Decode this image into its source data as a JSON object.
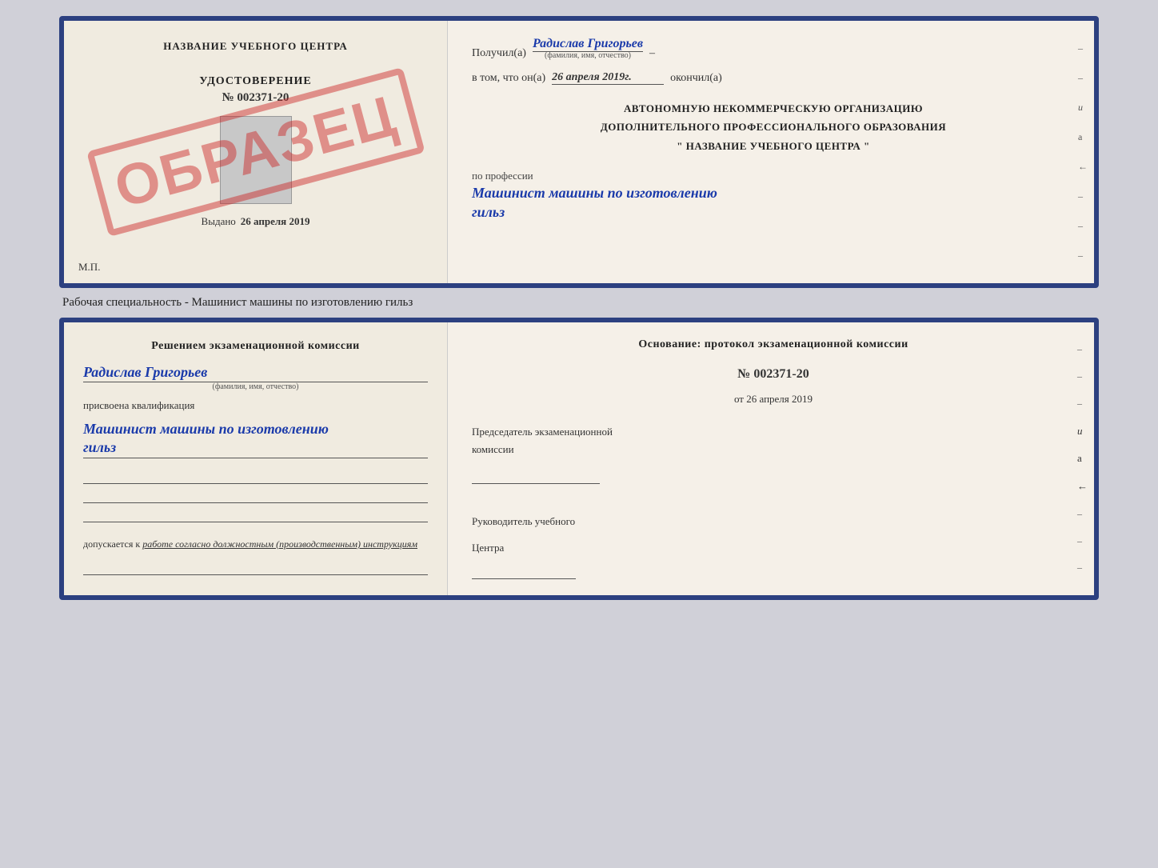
{
  "top_document": {
    "left": {
      "school_name": "НАЗВАНИЕ УЧЕБНОГО ЦЕНТРА",
      "stamp_text": "ОБРАЗЕЦ",
      "cert_title": "УДОСТОВЕРЕНИЕ",
      "cert_number": "№ 002371-20",
      "issued_label": "Выдано",
      "issued_date": "26 апреля 2019",
      "mp_label": "М.П."
    },
    "right": {
      "recipient_prefix": "Получил(а)",
      "recipient_name": "Радислав Григорьев",
      "fio_hint": "(фамилия, имя, отчество)",
      "dash": "–",
      "date_prefix": "в том, что он(а)",
      "date_value": "26 апреля 2019г.",
      "date_suffix": "окончил(а)",
      "org_line1": "АВТОНОМНУЮ НЕКОММЕРЧЕСКУЮ ОРГАНИЗАЦИЮ",
      "org_line2": "ДОПОЛНИТЕЛЬНОГО ПРОФЕССИОНАЛЬНОГО ОБРАЗОВАНИЯ",
      "org_line3": "\" НАЗВАНИЕ УЧЕБНОГО ЦЕНТРА \"",
      "profession_label": "по профессии",
      "profession_name": "Машинист машины по изготовлению",
      "profession_name2": "гильз"
    }
  },
  "caption": "Рабочая специальность - Машинист машины по изготовлению гильз",
  "bottom_document": {
    "left": {
      "commission_title": "Решением  экзаменационной  комиссии",
      "person_name": "Радислав Григорьев",
      "fio_hint": "(фамилия, имя, отчество)",
      "qualification_label": "присвоена квалификация",
      "qualification_name": "Машинист машины по изготовлению",
      "qualification_name2": "гильз",
      "admission_text": "допускается к",
      "admission_italic": "работе согласно должностным (производственным) инструкциям"
    },
    "right": {
      "basis_title": "Основание: протокол экзаменационной  комиссии",
      "basis_number": "№  002371-20",
      "basis_date_prefix": "от",
      "basis_date": "26 апреля 2019",
      "chairman_label1": "Председатель экзаменационной",
      "chairman_label2": "комиссии",
      "director_label1": "Руководитель учебного",
      "director_label2": "Центра",
      "side_markers": [
        "–",
        "–",
        "–",
        "и",
        "а",
        "←",
        "–",
        "–",
        "–"
      ]
    }
  }
}
